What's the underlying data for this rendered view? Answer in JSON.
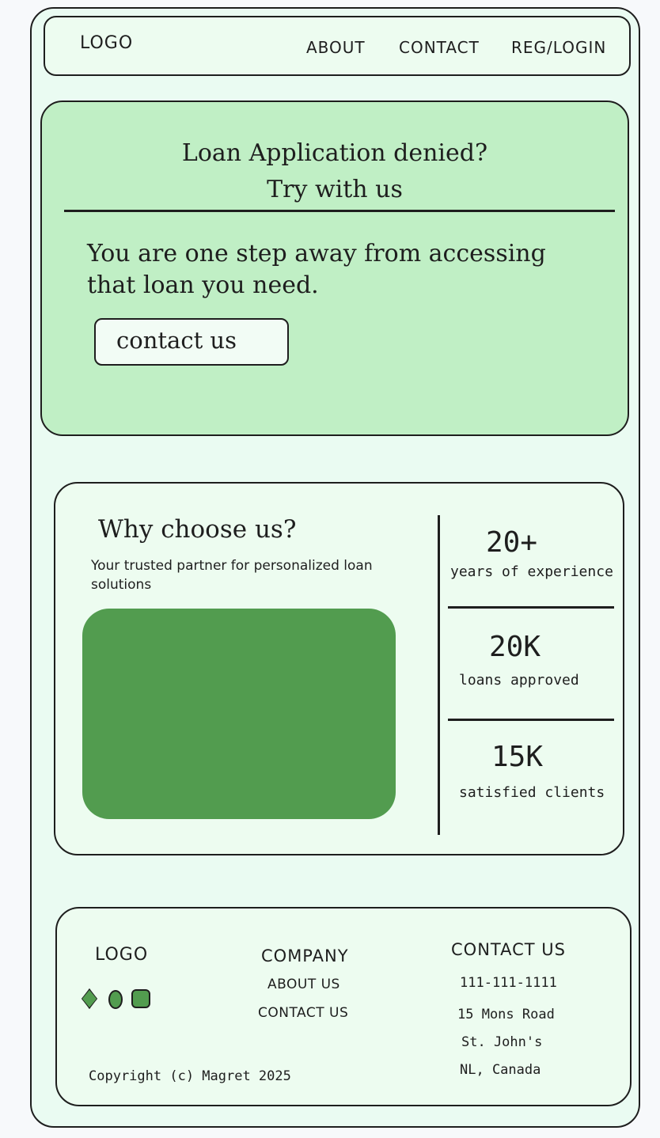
{
  "nav": {
    "logo": "LOGO",
    "links": [
      "ABOUT",
      "CONTACT",
      "REG/LOGIN"
    ]
  },
  "hero": {
    "title_line1": "Loan Application denied?",
    "title_line2": "Try with us",
    "text": "You are one step away from accessing that loan you need.",
    "button_label": "contact us"
  },
  "why": {
    "title": "Why choose us?",
    "subtitle": "Your trusted partner for personalized loan solutions",
    "stats": [
      {
        "value": "20+",
        "label": "years of experience"
      },
      {
        "value": "20K",
        "label": "loans approved"
      },
      {
        "value": "15K",
        "label": "satisfied clients"
      }
    ]
  },
  "footer": {
    "logo": "LOGO",
    "copyright": "Copyright (c) Magret 2025",
    "company_title": "COMPANY",
    "company_links": [
      "ABOUT US",
      "CONTACT US"
    ],
    "contact_title": "CONTACT US",
    "phone": "111-111-1111",
    "address": [
      "15 Mons Road",
      "St. John's",
      "NL, Canada"
    ]
  },
  "colors": {
    "page_bg": "#eafbf2",
    "hero_bg": "#c0efc5",
    "card_bg": "#edfcf0",
    "accent_green": "#529c4f",
    "stroke": "#1e1e1e"
  },
  "icons": [
    "diamond-icon",
    "oval-icon",
    "rounded-square-icon"
  ]
}
